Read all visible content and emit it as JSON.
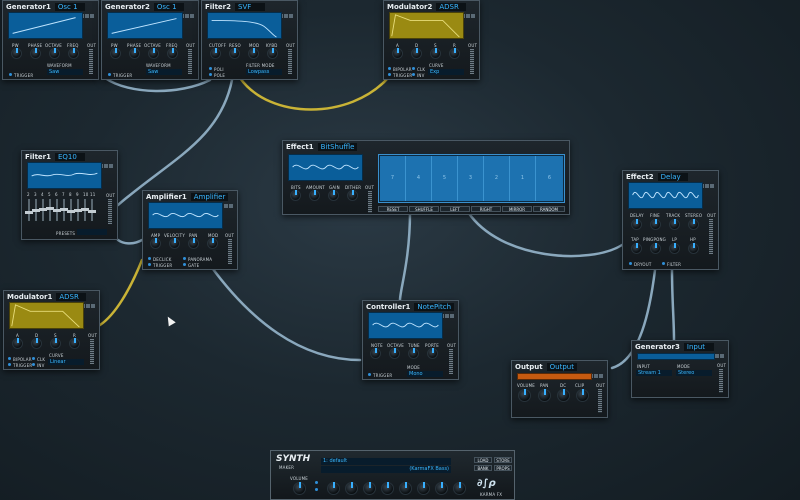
{
  "colors": {
    "wire_blue": "#8aa8bd",
    "wire_yellow": "#c9b336",
    "accent": "#39b6ff",
    "scope_blue": "#0a5e9a",
    "scope_yellow": "#9a8a12"
  },
  "modules": {
    "generator1": {
      "name": "Generator1",
      "type": "Osc 1",
      "knobs": [
        "PW",
        "PHASE",
        "OCTAVE",
        "FREQ"
      ],
      "out": "OUT",
      "trigger": "TRIGGER",
      "waveform_label": "WAVEFORM",
      "waveform": "Saw"
    },
    "generator2": {
      "name": "Generator2",
      "type": "Osc 1",
      "knobs": [
        "PW",
        "PHASE",
        "OCTAVE",
        "FREQ"
      ],
      "out": "OUT",
      "trigger": "TRIGGER",
      "waveform_label": "WAVEFORM",
      "waveform": "Saw"
    },
    "filter2": {
      "name": "Filter2",
      "type": "SVF",
      "knobs": [
        "CUTOFF",
        "RESO",
        "MOD",
        "KYBD"
      ],
      "out": "OUT",
      "opt1": "POLI",
      "opt2": "POLE",
      "mode_label": "FILTER MODE",
      "mode": "Lowpass"
    },
    "modulator2": {
      "name": "Modulator2",
      "type": "ADSR",
      "knobs": [
        "A",
        "D",
        "S",
        "R"
      ],
      "out": "OUT",
      "opts": [
        "BIPOLAR",
        "CLK",
        "TRIGGER",
        "INV"
      ],
      "curve_label": "CURVE",
      "curve": "Exp"
    },
    "filter1": {
      "name": "Filter1",
      "type": "EQ10",
      "bands": [
        "2",
        "3",
        "4",
        "5",
        "6",
        "7",
        "8",
        "9",
        "10",
        "11"
      ],
      "out": "OUT",
      "presets_label": "PRESETS"
    },
    "amplifier1": {
      "name": "Amplifier1",
      "type": "Amplifier",
      "knobs": [
        "AMP",
        "VELOCITY",
        "PAN",
        "MOD"
      ],
      "out": "OUT",
      "opts": [
        "DECLICK",
        "PANORAMA",
        "TRIGGER",
        "GATE"
      ]
    },
    "effect1": {
      "name": "Effect1",
      "type": "BitShuffle",
      "knobs": [
        "BITS",
        "AMOUNT",
        "GAIN",
        "DITHER"
      ],
      "out": "OUT",
      "cells": [
        "7",
        "4",
        "5",
        "3",
        "2",
        "1",
        "6"
      ],
      "buttons": [
        "RESET",
        "SHUFFLE",
        "LEFT",
        "RIGHT",
        "MIRROR",
        "RANDOM"
      ]
    },
    "effect2": {
      "name": "Effect2",
      "type": "Delay",
      "knobs": [
        "DELAY",
        "FINE",
        "TRACK",
        "STEREO",
        "TAP",
        "PINGPONG",
        "LP",
        "HP"
      ],
      "out": "OUT",
      "opts": [
        "DRYOUT",
        "FILTER"
      ]
    },
    "modulator1": {
      "name": "Modulator1",
      "type": "ADSR",
      "knobs": [
        "A",
        "D",
        "S",
        "R"
      ],
      "out": "OUT",
      "opts": [
        "BIPOLAR",
        "CLK",
        "TRIGGER",
        "INV"
      ],
      "curve_label": "CURVE",
      "curve": "Linear"
    },
    "controller1": {
      "name": "Controller1",
      "type": "NotePitch",
      "knobs": [
        "NOTE",
        "OCTAVE",
        "TUNE",
        "PORTE"
      ],
      "out": "OUT",
      "trigger": "TRIGGER",
      "mode_label": "MODE",
      "mode": "Mono"
    },
    "output": {
      "name": "Output",
      "type": "Output",
      "knobs": [
        "VOLUME",
        "PAN",
        "DC",
        "CLIP"
      ],
      "out": "OUT"
    },
    "generator3": {
      "name": "Generator3",
      "type": "Input",
      "input_label": "INPUT",
      "input": "Stream 1",
      "mode_label": "MODE",
      "mode": "Stereo",
      "out": "OUT"
    }
  },
  "synth": {
    "logo": "SYNTH",
    "logo_sub": "MAKER",
    "preset": "1: default",
    "preset_name": "(KarmaFX Bass)",
    "volume_label": "VOLUME",
    "buttons": [
      "LOAD",
      "STORE",
      "BANK",
      "PROPS"
    ],
    "brand": "KARMA FX"
  }
}
